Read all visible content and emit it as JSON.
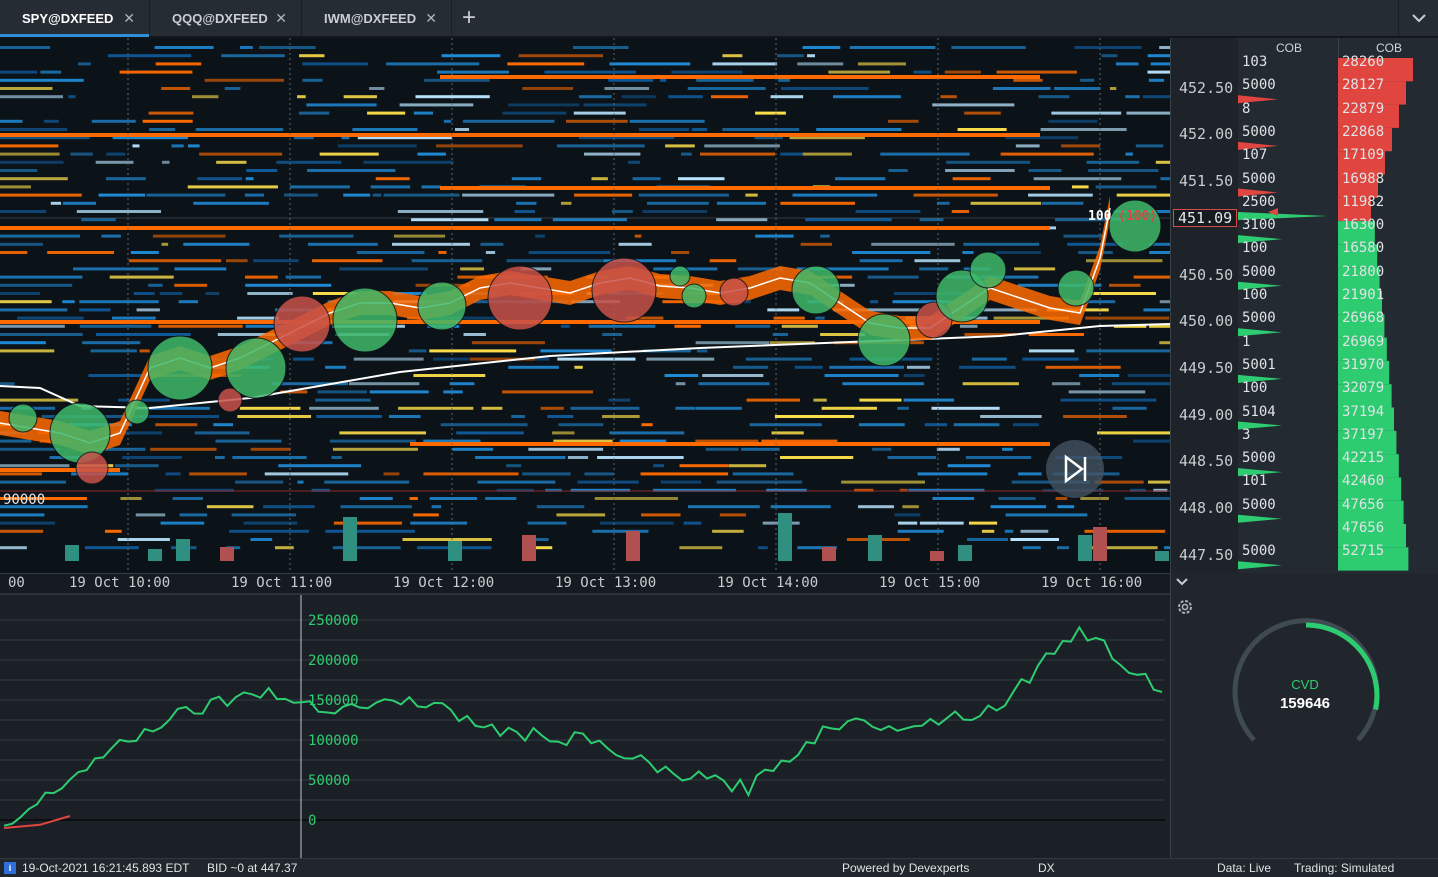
{
  "tabs": [
    {
      "label": "SPY@DXFEED",
      "active": true
    },
    {
      "label": "QQQ@DXFEED",
      "active": false
    },
    {
      "label": "IWM@DXFEED",
      "active": false
    }
  ],
  "add_tab_icon": "plus-icon",
  "tab_menu_icon": "chevron-down-icon",
  "price_axis": {
    "labels": [
      "452.50",
      "452.00",
      "451.50",
      "450.50",
      "450.00",
      "449.50",
      "449.00",
      "448.50",
      "448.00",
      "447.50"
    ],
    "current_price": "451.09"
  },
  "cob": {
    "headers": [
      "COB",
      "COB"
    ],
    "rows": [
      {
        "left": "103",
        "right": "28260"
      },
      {
        "left": "5000",
        "right": "28127"
      },
      {
        "left": "8",
        "right": "22879"
      },
      {
        "left": "5000",
        "right": "22868"
      },
      {
        "left": "107",
        "right": "17109"
      },
      {
        "left": "5000",
        "right": "16988"
      },
      {
        "left": "2500",
        "right": "11982"
      },
      {
        "left": "3100",
        "right": "16300"
      },
      {
        "left": "100",
        "right": "16580"
      },
      {
        "left": "5000",
        "right": "21800"
      },
      {
        "left": "100",
        "right": "21901"
      },
      {
        "left": "5000",
        "right": "26968"
      },
      {
        "left": "1",
        "right": "26969"
      },
      {
        "left": "5001",
        "right": "31970"
      },
      {
        "left": "100",
        "right": "32079"
      },
      {
        "left": "5104",
        "right": "37194"
      },
      {
        "left": "3",
        "right": "37197"
      },
      {
        "left": "5000",
        "right": "42215"
      },
      {
        "left": "101",
        "right": "42460"
      },
      {
        "left": "5000",
        "right": "47656"
      },
      {
        "left": "",
        "right": "47656"
      },
      {
        "left": "5000",
        "right": "52715"
      }
    ]
  },
  "heatmap": {
    "volume_scale_label": "90000",
    "last_trade_label": "100",
    "last_trade_size": "(100)",
    "replay_button_icon": "play-next-icon"
  },
  "time_axis": [
    "00",
    "19 Oct 10:00",
    "19 Oct 11:00",
    "19 Oct 12:00",
    "19 Oct 13:00",
    "19 Oct 14:00",
    "19 Oct 15:00",
    "19 Oct 16:00"
  ],
  "indicator": {
    "y_labels": [
      "250000",
      "200000",
      "150000",
      "100000",
      "50000",
      "0"
    ]
  },
  "cvd": {
    "label": "CVD",
    "value": "159646",
    "gear_icon": "gear-icon",
    "collapse_icon": "chevron-down-icon"
  },
  "status": {
    "datetime": "19-Oct-2021 16:21:45.893 EDT",
    "bid": "BID ~0 at 447.37",
    "powered": "Powered by Devexperts",
    "dx": "DX",
    "data": "Data: Live",
    "trading": "Trading: Simulated"
  },
  "colors": {
    "accent": "#2f8fd8",
    "bid_green": "#2ecc71",
    "ask_red": "#e0453f",
    "heat_orange": "#ff6a00",
    "heat_blue": "#1f8ad6",
    "heat_yellow": "#ffe14a"
  },
  "chart_data": {
    "type": "line",
    "title": "",
    "series": [
      {
        "name": "CVD",
        "x": [
          "09:30",
          "10:00",
          "10:30",
          "11:00",
          "11:30",
          "12:00",
          "12:30",
          "13:00",
          "13:30",
          "14:00",
          "14:30",
          "15:00",
          "15:30",
          "16:00",
          "16:20"
        ],
        "values": [
          -10000,
          70000,
          130000,
          160000,
          140000,
          150000,
          110000,
          100000,
          60000,
          40000,
          120000,
          120000,
          140000,
          240000,
          160000
        ]
      }
    ],
    "ylim": [
      -20000,
      270000
    ],
    "y_ticks": [
      0,
      50000,
      100000,
      150000,
      200000,
      250000
    ]
  }
}
